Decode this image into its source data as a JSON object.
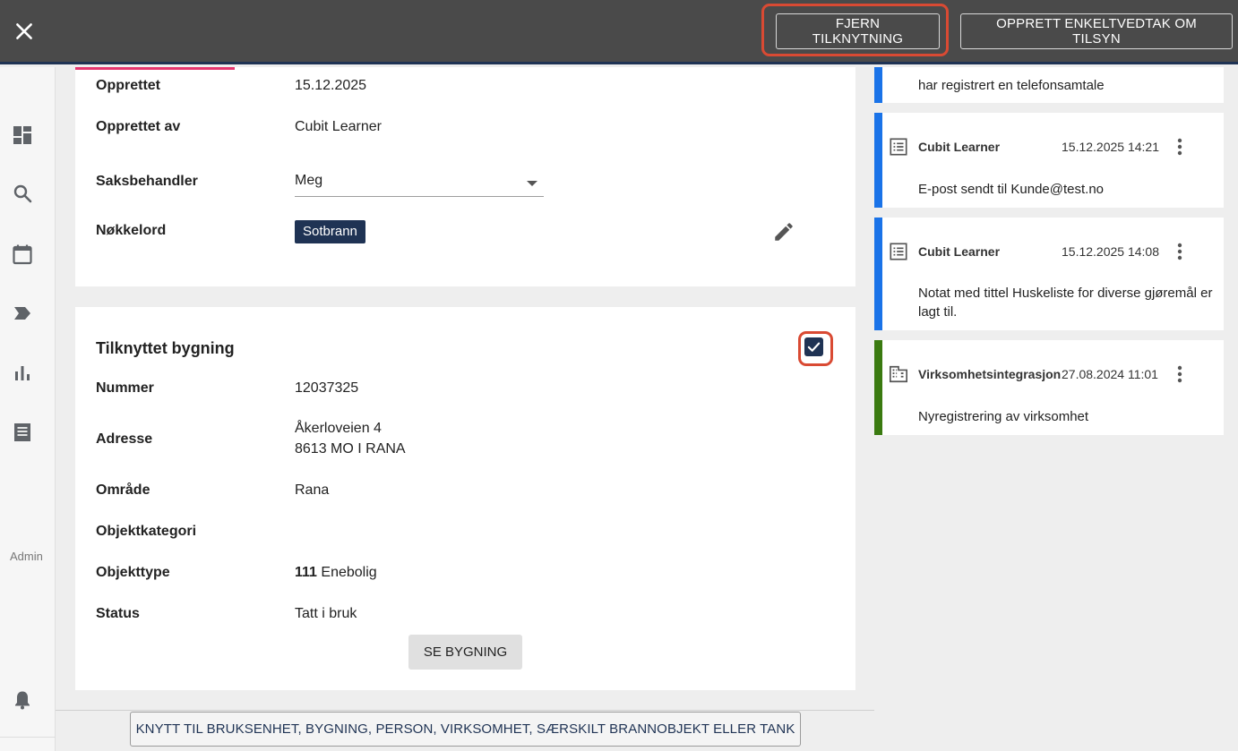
{
  "header": {
    "remove_link_label": "FJERN TILKNYTNING",
    "create_decision_label": "OPPRETT ENKELTVEDTAK OM TILSYN"
  },
  "sidebar": {
    "items": [
      {
        "icon": "dashboard-icon"
      },
      {
        "icon": "search-icon"
      },
      {
        "icon": "calendar-icon"
      },
      {
        "icon": "label-icon"
      },
      {
        "icon": "bar-chart-icon"
      },
      {
        "icon": "receipt-icon"
      }
    ],
    "admin_label": "Admin",
    "bell_icon": "notification-bell-icon"
  },
  "case_info": {
    "created_label": "Opprettet",
    "created_value": "15.12.2025",
    "created_by_label": "Opprettet av",
    "created_by_value": "Cubit Learner",
    "handler_label": "Saksbehandler",
    "handler_value": "Meg",
    "keywords_label": "Nøkkelord",
    "keyword_chip": "Sotbrann"
  },
  "building": {
    "title": "Tilknyttet bygning",
    "number_label": "Nummer",
    "number_value": "12037325",
    "address_label": "Adresse",
    "address_line1": "Åkerloveien 4",
    "address_line2": "8613 MO I RANA",
    "area_label": "Område",
    "area_value": "Rana",
    "category_label": "Objektkategori",
    "category_value": "",
    "type_label": "Objekttype",
    "type_code": "111",
    "type_value": "Enebolig",
    "status_label": "Status",
    "status_value": "Tatt i bruk",
    "see_button": "SE BYGNING"
  },
  "link_button": "KNYTT TIL BRUKSENHET, BYGNING, PERSON, VIRKSOMHET, SÆRSKILT BRANNOBJEKT ELLER TANK",
  "timeline": [
    {
      "text": "har registrert en telefonsamtale",
      "color": "#1a73e8"
    },
    {
      "author": "Cubit Learner",
      "time": "15.12.2025 14:21",
      "text": "E-post sendt til Kunde@test.no",
      "icon": "list-icon",
      "color": "#1a73e8"
    },
    {
      "author": "Cubit Learner",
      "time": "15.12.2025 14:08",
      "text": "Notat med tittel Huskeliste for diverse gjøremål er lagt til.",
      "icon": "list-icon",
      "color": "#1a73e8"
    },
    {
      "author": "Virksomhetsintegrasjon",
      "time": "27.08.2024 11:01",
      "text": "Nyregistrering av virksomhet",
      "icon": "building-icon",
      "color": "#3a7a10"
    }
  ],
  "colors": {
    "topbar": "#4a4a4a",
    "navy": "#1f3354",
    "highlight": "#d94a33",
    "accent_pink": "#e6356f"
  }
}
